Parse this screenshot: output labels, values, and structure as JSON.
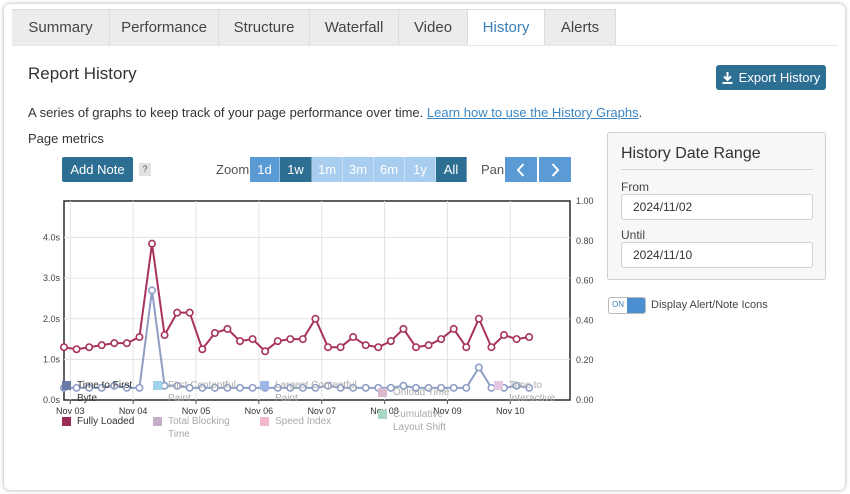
{
  "tabs": [
    {
      "label": "Summary",
      "active": false
    },
    {
      "label": "Performance",
      "active": false
    },
    {
      "label": "Structure",
      "active": false
    },
    {
      "label": "Waterfall",
      "active": false
    },
    {
      "label": "Video",
      "active": false
    },
    {
      "label": "History",
      "active": true
    },
    {
      "label": "Alerts",
      "active": false
    }
  ],
  "header": {
    "title": "Report History",
    "export_label": "Export History",
    "description": "A series of graphs to keep track of your page performance over time.",
    "link_text": "Learn how to use the History Graphs",
    "description_end": "."
  },
  "metrics": {
    "title": "Page metrics",
    "add_note_label": "Add Note",
    "help_label": "?",
    "zoom_label": "Zoom",
    "zoom_options": [
      {
        "label": "1d",
        "state": "normal"
      },
      {
        "label": "1w",
        "state": "selected"
      },
      {
        "label": "1m",
        "state": "disabled"
      },
      {
        "label": "3m",
        "state": "disabled"
      },
      {
        "label": "6m",
        "state": "disabled"
      },
      {
        "label": "1y",
        "state": "disabled"
      },
      {
        "label": "All",
        "state": "selected"
      }
    ],
    "pan_label": "Pan",
    "pan_left_icon": "chevron-left-icon",
    "pan_right_icon": "chevron-right-icon"
  },
  "chart_data": {
    "type": "line",
    "title": "",
    "xlabel": "",
    "ylabel": "",
    "x_tick_labels": [
      "Nov 03",
      "Nov 04",
      "Nov 05",
      "Nov 06",
      "Nov 07",
      "Nov 08",
      "Nov 09",
      "Nov 10"
    ],
    "y_left_ticks": [
      "0.0s",
      "1.0s",
      "2.0s",
      "3.0s",
      "4.0s"
    ],
    "y_left_range": [
      0,
      4.9
    ],
    "y_right_ticks": [
      "0.00",
      "0.20",
      "0.40",
      "0.60",
      "0.80",
      "1.00"
    ],
    "y_right_range": [
      0,
      1.0
    ],
    "grid": true,
    "x_days": [
      2.9,
      3.1,
      3.3,
      3.5,
      3.7,
      3.9,
      4.1,
      4.3,
      4.5,
      4.7,
      4.9,
      5.1,
      5.3,
      5.5,
      5.7,
      5.9,
      6.1,
      6.3,
      6.5,
      6.7,
      6.9,
      7.1,
      7.3,
      7.5,
      7.7,
      7.9,
      8.1,
      8.3,
      8.5,
      8.7,
      8.9,
      9.1,
      9.3,
      9.5,
      9.7,
      9.9,
      10.1,
      10.3,
      10.5,
      10.7,
      10.9
    ],
    "series": [
      {
        "name": "Fully Loaded",
        "color": "#a8325e",
        "values": [
          1.3,
          1.25,
          1.3,
          1.35,
          1.4,
          1.4,
          1.55,
          3.85,
          1.6,
          2.15,
          2.15,
          1.25,
          1.65,
          1.75,
          1.45,
          1.5,
          1.2,
          1.45,
          1.5,
          1.5,
          2.0,
          1.3,
          1.3,
          1.55,
          1.35,
          1.3,
          1.45,
          1.75,
          1.3,
          1.35,
          1.5,
          1.75,
          1.3,
          2.0,
          1.3,
          1.6,
          1.5,
          1.55
        ]
      },
      {
        "name": "Time to First Byte",
        "color": "#8e9ec5",
        "values": [
          0.3,
          0.3,
          0.3,
          0.3,
          0.35,
          0.3,
          0.3,
          2.7,
          0.35,
          0.35,
          0.3,
          0.3,
          0.3,
          0.3,
          0.3,
          0.3,
          0.3,
          0.3,
          0.3,
          0.3,
          0.3,
          0.35,
          0.3,
          0.3,
          0.3,
          0.3,
          0.3,
          0.35,
          0.3,
          0.3,
          0.3,
          0.3,
          0.3,
          0.8,
          0.3,
          0.3,
          0.35,
          0.3
        ]
      }
    ],
    "legend": [
      {
        "label": "Time to First Byte",
        "color": "#6c7aa8",
        "active": true
      },
      {
        "label": "First Contentful Paint",
        "color": "#9fd3ee",
        "active": false
      },
      {
        "label": "Largest Contentful Paint",
        "color": "#9cb6e8",
        "active": false
      },
      {
        "label": "Onload Time",
        "color": "#d9b9cd",
        "active": false
      },
      {
        "label": "Time to Interactive",
        "color": "#e6c7e3",
        "active": false
      },
      {
        "label": "Fully Loaded",
        "color": "#9c2b55",
        "active": true
      },
      {
        "label": "Total Blocking Time",
        "color": "#c5aec6",
        "active": false
      },
      {
        "label": "Speed Index",
        "color": "#f3b8d0",
        "active": false
      },
      {
        "label": "Cumulative Layout Shift",
        "color": "#a9d8c4",
        "active": false
      }
    ]
  },
  "date_range": {
    "title": "History Date Range",
    "from_label": "From",
    "from_value": "2024/11/02",
    "until_label": "Until",
    "until_value": "2024/11/10"
  },
  "toggle": {
    "state_label": "ON",
    "label": "Display Alert/Note Icons"
  }
}
